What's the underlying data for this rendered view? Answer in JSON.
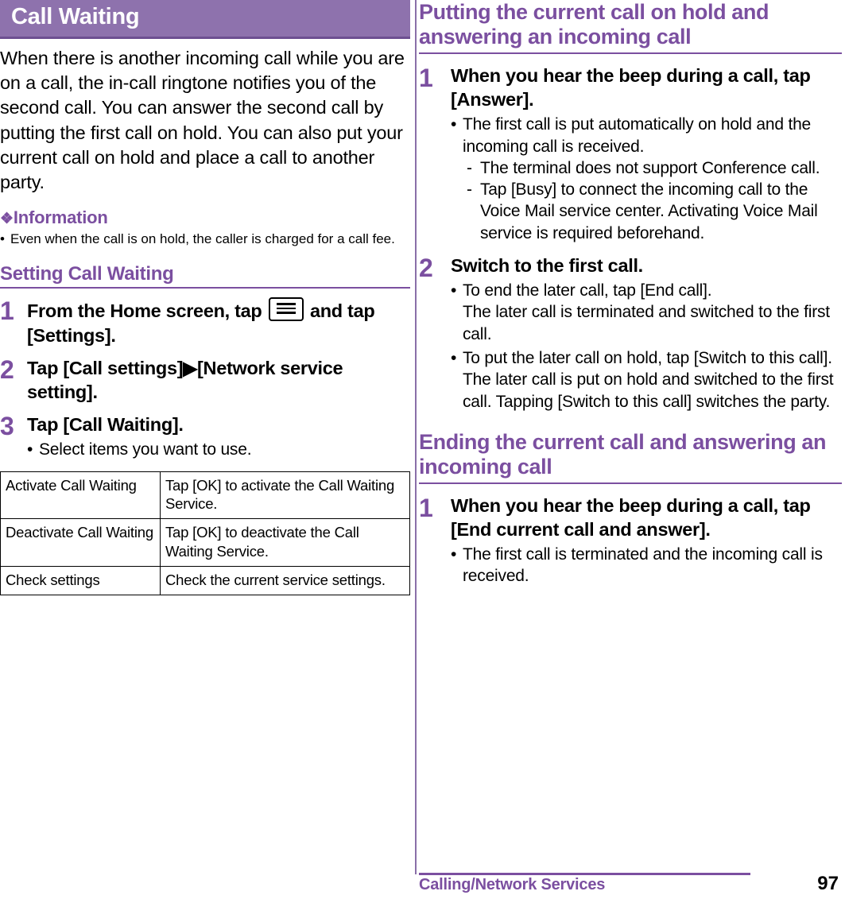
{
  "left": {
    "title": "Call Waiting",
    "intro": "When there is another incoming call while you are on a call, the in-call ringtone notifies you of the second call. You can answer the second call by putting the first call on hold. You can also put your current call on hold and place a call to another party.",
    "information_heading": "Information",
    "information_bullets": [
      "Even when the call is on hold, the caller is charged for a call fee."
    ],
    "section_heading": "Setting Call Waiting",
    "steps": [
      {
        "num": "1",
        "title_before": "From the Home screen, tap",
        "icon": "menu-icon",
        "title_after": "and tap [Settings].",
        "bullets": []
      },
      {
        "num": "2",
        "title": "Tap [Call settings]▶[Network service setting].",
        "bullets": []
      },
      {
        "num": "3",
        "title": "Tap [Call Waiting].",
        "bullets": [
          "Select items you want to use."
        ]
      }
    ],
    "table": {
      "rows": [
        {
          "item": "Activate Call Waiting",
          "description": "Tap [OK] to activate the Call Waiting Service."
        },
        {
          "item": "Deactivate Call Waiting",
          "description": "Tap [OK] to deactivate the Call Waiting Service."
        },
        {
          "item": "Check settings",
          "description": "Check the current service settings."
        }
      ]
    }
  },
  "right": {
    "heading1": "Putting the current call on hold and answering an incoming call",
    "section1_steps": [
      {
        "num": "1",
        "title": "When you hear the beep during a call, tap [Answer].",
        "bullets": [
          "The first call is put automatically on hold and the incoming call is received."
        ],
        "dashes": [
          "The terminal does not support Conference call.",
          "Tap [Busy] to connect the incoming call to the Voice Mail service center. Activating Voice Mail service is required beforehand."
        ]
      },
      {
        "num": "2",
        "title": "Switch to the first call.",
        "bullets": [
          "To end the later call, tap [End call].\nThe later call is terminated and switched to the first call.",
          "To put the later call on hold, tap [Switch to this call].\nThe later call is put on hold and switched to the first call. Tapping [Switch to this call] switches the party."
        ],
        "dashes": []
      }
    ],
    "heading2": "Ending the current call and answering an incoming call",
    "section2_steps": [
      {
        "num": "1",
        "title": "When you hear the beep during a call, tap [End current call and answer].",
        "bullets": [
          "The first call is terminated and the incoming call is received."
        ],
        "dashes": []
      }
    ]
  },
  "footer": {
    "chapter": "Calling/Network Services",
    "page_number": "97"
  },
  "colors": {
    "accent": "#7b4fa0",
    "title_bar": "#8e72ad",
    "text": "#000000"
  }
}
